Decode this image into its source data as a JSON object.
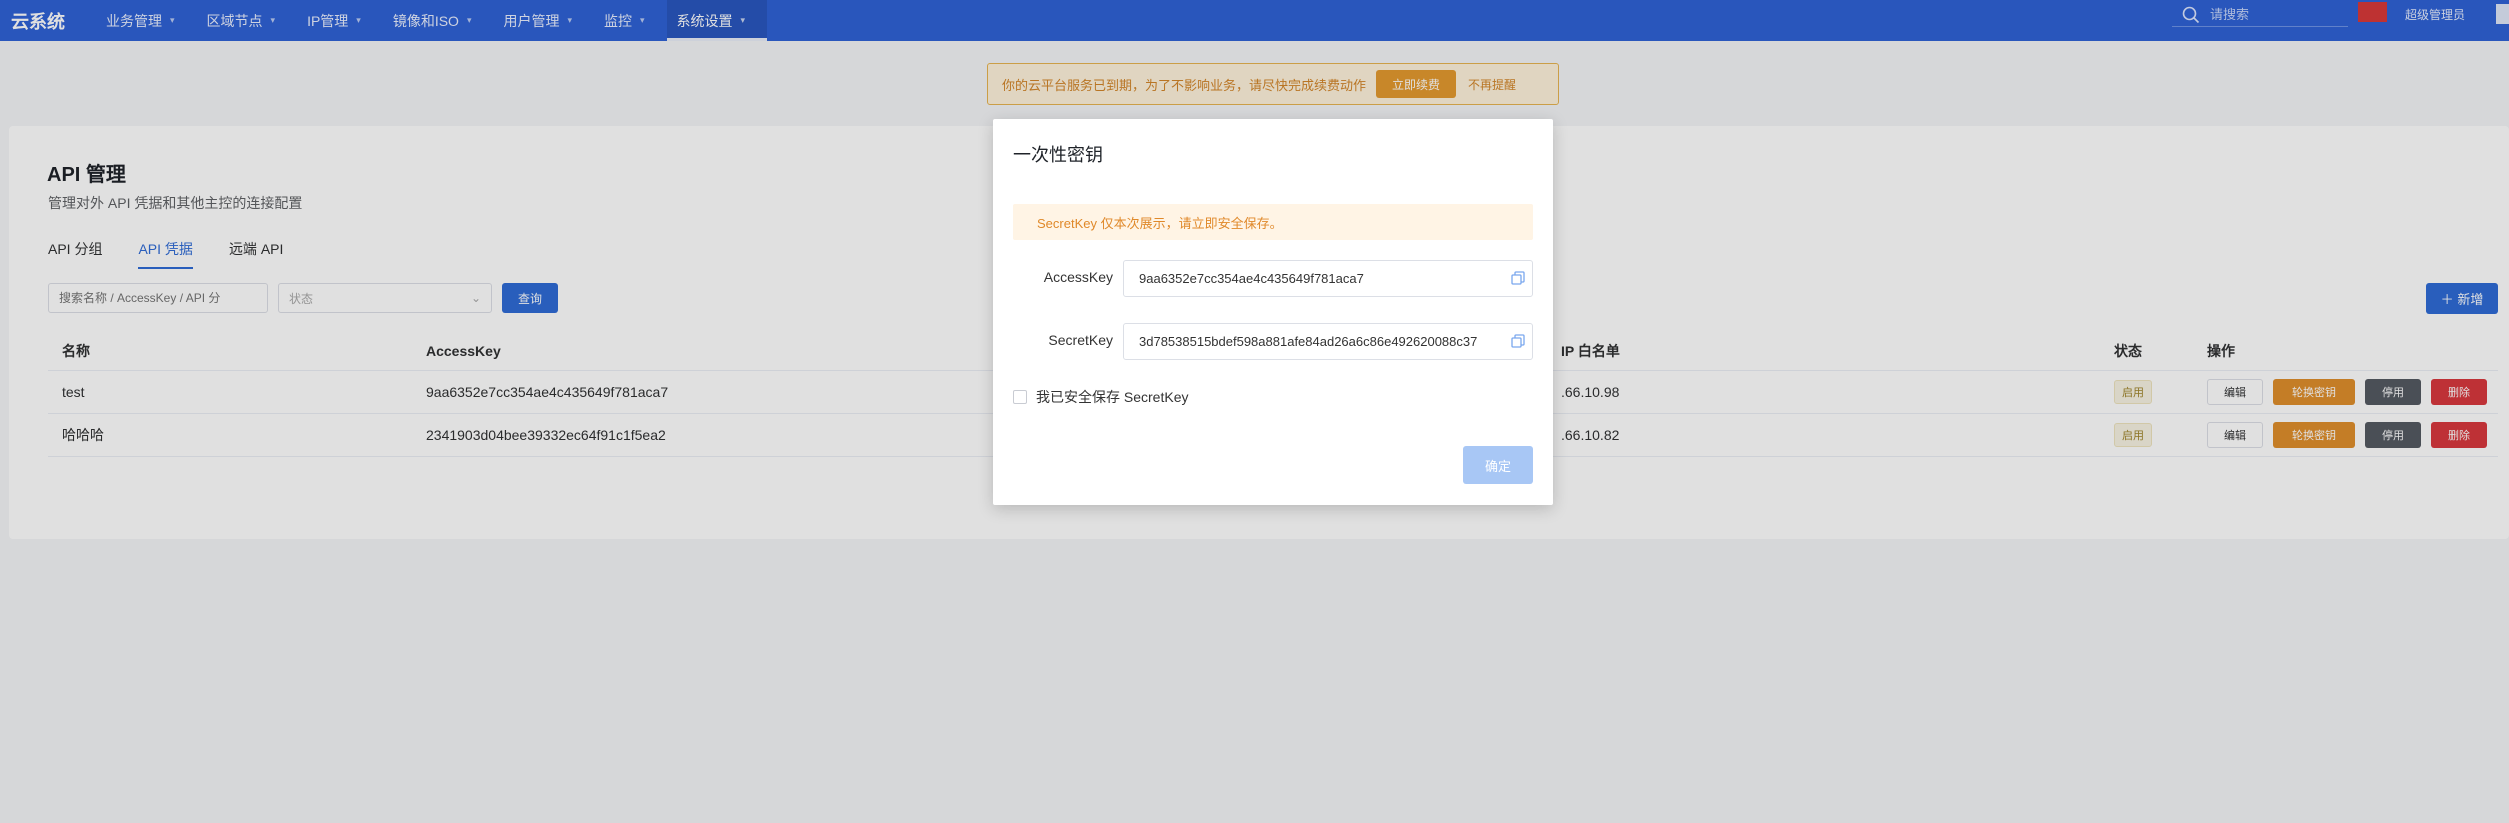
{
  "brand": "云系统",
  "nav": [
    {
      "label": "业务管理",
      "active": false
    },
    {
      "label": "区域节点",
      "active": false
    },
    {
      "label": "IP管理",
      "active": false
    },
    {
      "label": "镜像和ISO",
      "active": false
    },
    {
      "label": "用户管理",
      "active": false
    },
    {
      "label": "监控",
      "active": false
    },
    {
      "label": "系统设置",
      "active": true
    }
  ],
  "search": {
    "placeholder": "请搜索"
  },
  "user": "超级管理员",
  "notice": {
    "text": "你的云平台服务已到期，为了不影响业务，请尽快完成续费动作",
    "renew": "立即续费",
    "dismiss": "不再提醒"
  },
  "page": {
    "title": "API 管理",
    "subtitle": "管理对外 API 凭据和其他主控的连接配置",
    "tabs": [
      "API 分组",
      "API 凭据",
      "远端 API"
    ],
    "filter": {
      "search_placeholder": "搜索名称 / AccessKey / API 分",
      "status_placeholder": "状态",
      "query": "查询"
    },
    "add": "新增",
    "columns": {
      "name": "名称",
      "access_key": "AccessKey",
      "ip": "IP 白名单",
      "status": "状态",
      "ops": "操作"
    },
    "rows": [
      {
        "name": "test",
        "access_key": "9aa6352e7cc354ae4c435649f781aca7",
        "ip": ".66.10.98",
        "status": "启用"
      },
      {
        "name": "哈哈哈",
        "access_key": "2341903d04bee39332ec64f91c1f5ea2",
        "ip": ".66.10.82",
        "status": "启用"
      }
    ],
    "ops": {
      "edit": "编辑",
      "rotate": "轮换密钥",
      "disable": "停用",
      "delete": "删除"
    }
  },
  "modal": {
    "title": "一次性密钥",
    "warning": "SecretKey 仅本次展示，请立即安全保存。",
    "access_key_label": "AccessKey",
    "access_key": "9aa6352e7cc354ae4c435649f781aca7",
    "secret_key_label": "SecretKey",
    "secret_key": "3d78538515bdef598a881afe84ad26a6c86e492620088c37",
    "checkbox": "我已安全保存 SecretKey",
    "confirm": "确定"
  }
}
